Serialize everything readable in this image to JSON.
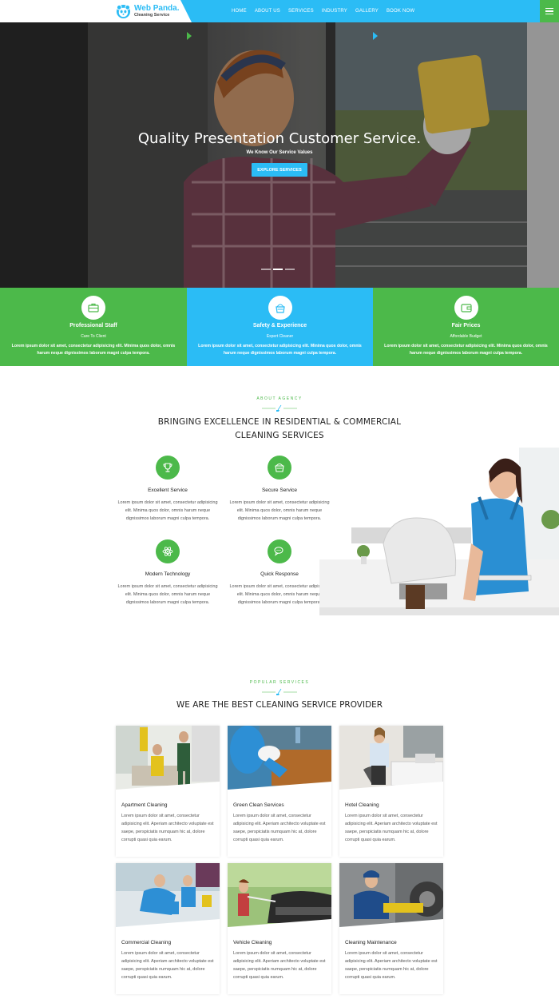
{
  "header": {
    "logo_name": "Web Panda.",
    "logo_sub": "Cleaning Service",
    "nav": [
      "HOME",
      "ABOUT US",
      "SERVICES",
      "INDUSTRY",
      "GALLERY",
      "BOOK NOW"
    ]
  },
  "hero": {
    "title": "Quality Presentation Customer Service.",
    "subtitle": "We Know Our Service Values",
    "button": "EXPLORE SERVICES"
  },
  "features": [
    {
      "title": "Professional Staff",
      "sub": "Care To Client",
      "text": "Lorem ipsum dolor sit amet, consectetur adipisicing elit. Minima quos dolor, omnis harum neque dignissimos laborum magni culpa tempora.",
      "icon": "briefcase-icon"
    },
    {
      "title": "Safety & Experience",
      "sub": "Expert Cleaner",
      "text": "Lorem ipsum dolor sit amet, consectetur adipisicing elit. Minima quos dolor, omnis harum neque dignissimos laborum magni culpa tempora.",
      "icon": "bucket-icon"
    },
    {
      "title": "Fair Prices",
      "sub": "Affordable Budget",
      "text": "Lorem ipsum dolor sit amet, consectetur adipisicing elit. Minima quos dolor, omnis harum neque dignissimos laborum magni culpa tempora.",
      "icon": "wallet-icon"
    }
  ],
  "about": {
    "tag": "ABOUT AGENCY",
    "title_line1": "BRINGING EXCELLENCE IN RESIDENTIAL & COMMERCIAL",
    "title_line2": "CLEANING SERVICES",
    "services": [
      {
        "title": "Excellent Service",
        "text": "Lorem ipsum dolor sit amet, consectetur adipisicing elit. Minima quos dolor, omnis harum neque dignissimos laborum magni culpa tempora.",
        "icon": "trophy-icon"
      },
      {
        "title": "Secure Service",
        "text": "Lorem ipsum dolor sit amet, consectetur adipisicing elit. Minima quos dolor, omnis harum neque dignissimos laborum magni culpa tempora.",
        "icon": "bucket-icon"
      },
      {
        "title": "Modern Technology",
        "text": "Lorem ipsum dolor sit amet, consectetur adipisicing elit. Minima quos dolor, omnis harum neque dignissimos laborum magni culpa tempora.",
        "icon": "atom-icon"
      },
      {
        "title": "Quick Response",
        "text": "Lorem ipsum dolor sit amet, consectetur adipisicing elit. Minima quos dolor, omnis harum neque dignissimos laborum magni culpa tempora.",
        "icon": "chat-icon"
      }
    ]
  },
  "popular": {
    "tag": "POPULAR SERVICES",
    "title": "WE ARE THE BEST CLEANING SERVICE PROVIDER",
    "cards": [
      {
        "title": "Apartment Cleaning",
        "text": "Lorem ipsum dolor sit amet, consectetur adipisicing elit. Aperiam architecto voluptate est saepe, perspiciatis numquam hic at, dolore corrupti quasi quia earum."
      },
      {
        "title": "Green Clean Services",
        "text": "Lorem ipsum dolor sit amet, consectetur adipisicing elit. Aperiam architecto voluptate est saepe, perspiciatis numquam hic at, dolore corrupti quasi quia earum."
      },
      {
        "title": "Hotel Cleaning",
        "text": "Lorem ipsum dolor sit amet, consectetur adipisicing elit. Aperiam architecto voluptate est saepe, perspiciatis numquam hic at, dolore corrupti quasi quia earum."
      },
      {
        "title": "Commercial Cleaning",
        "text": "Lorem ipsum dolor sit amet, consectetur adipisicing elit. Aperiam architecto voluptate est saepe, perspiciatis numquam hic at, dolore corrupti quasi quia earum."
      },
      {
        "title": "Vehicle Cleaning",
        "text": "Lorem ipsum dolor sit amet, consectetur adipisicing elit. Aperiam architecto voluptate est saepe, perspiciatis numquam hic at, dolore corrupti quasi quia earum."
      },
      {
        "title": "Cleaning Maintenance",
        "text": "Lorem ipsum dolor sit amet, consectetur adipisicing elit. Aperiam architecto voluptate est saepe, perspiciatis numquam hic at, dolore corrupti quasi quia earum."
      }
    ]
  },
  "colors": {
    "blue": "#2bbcf5",
    "green": "#4cb94a"
  }
}
